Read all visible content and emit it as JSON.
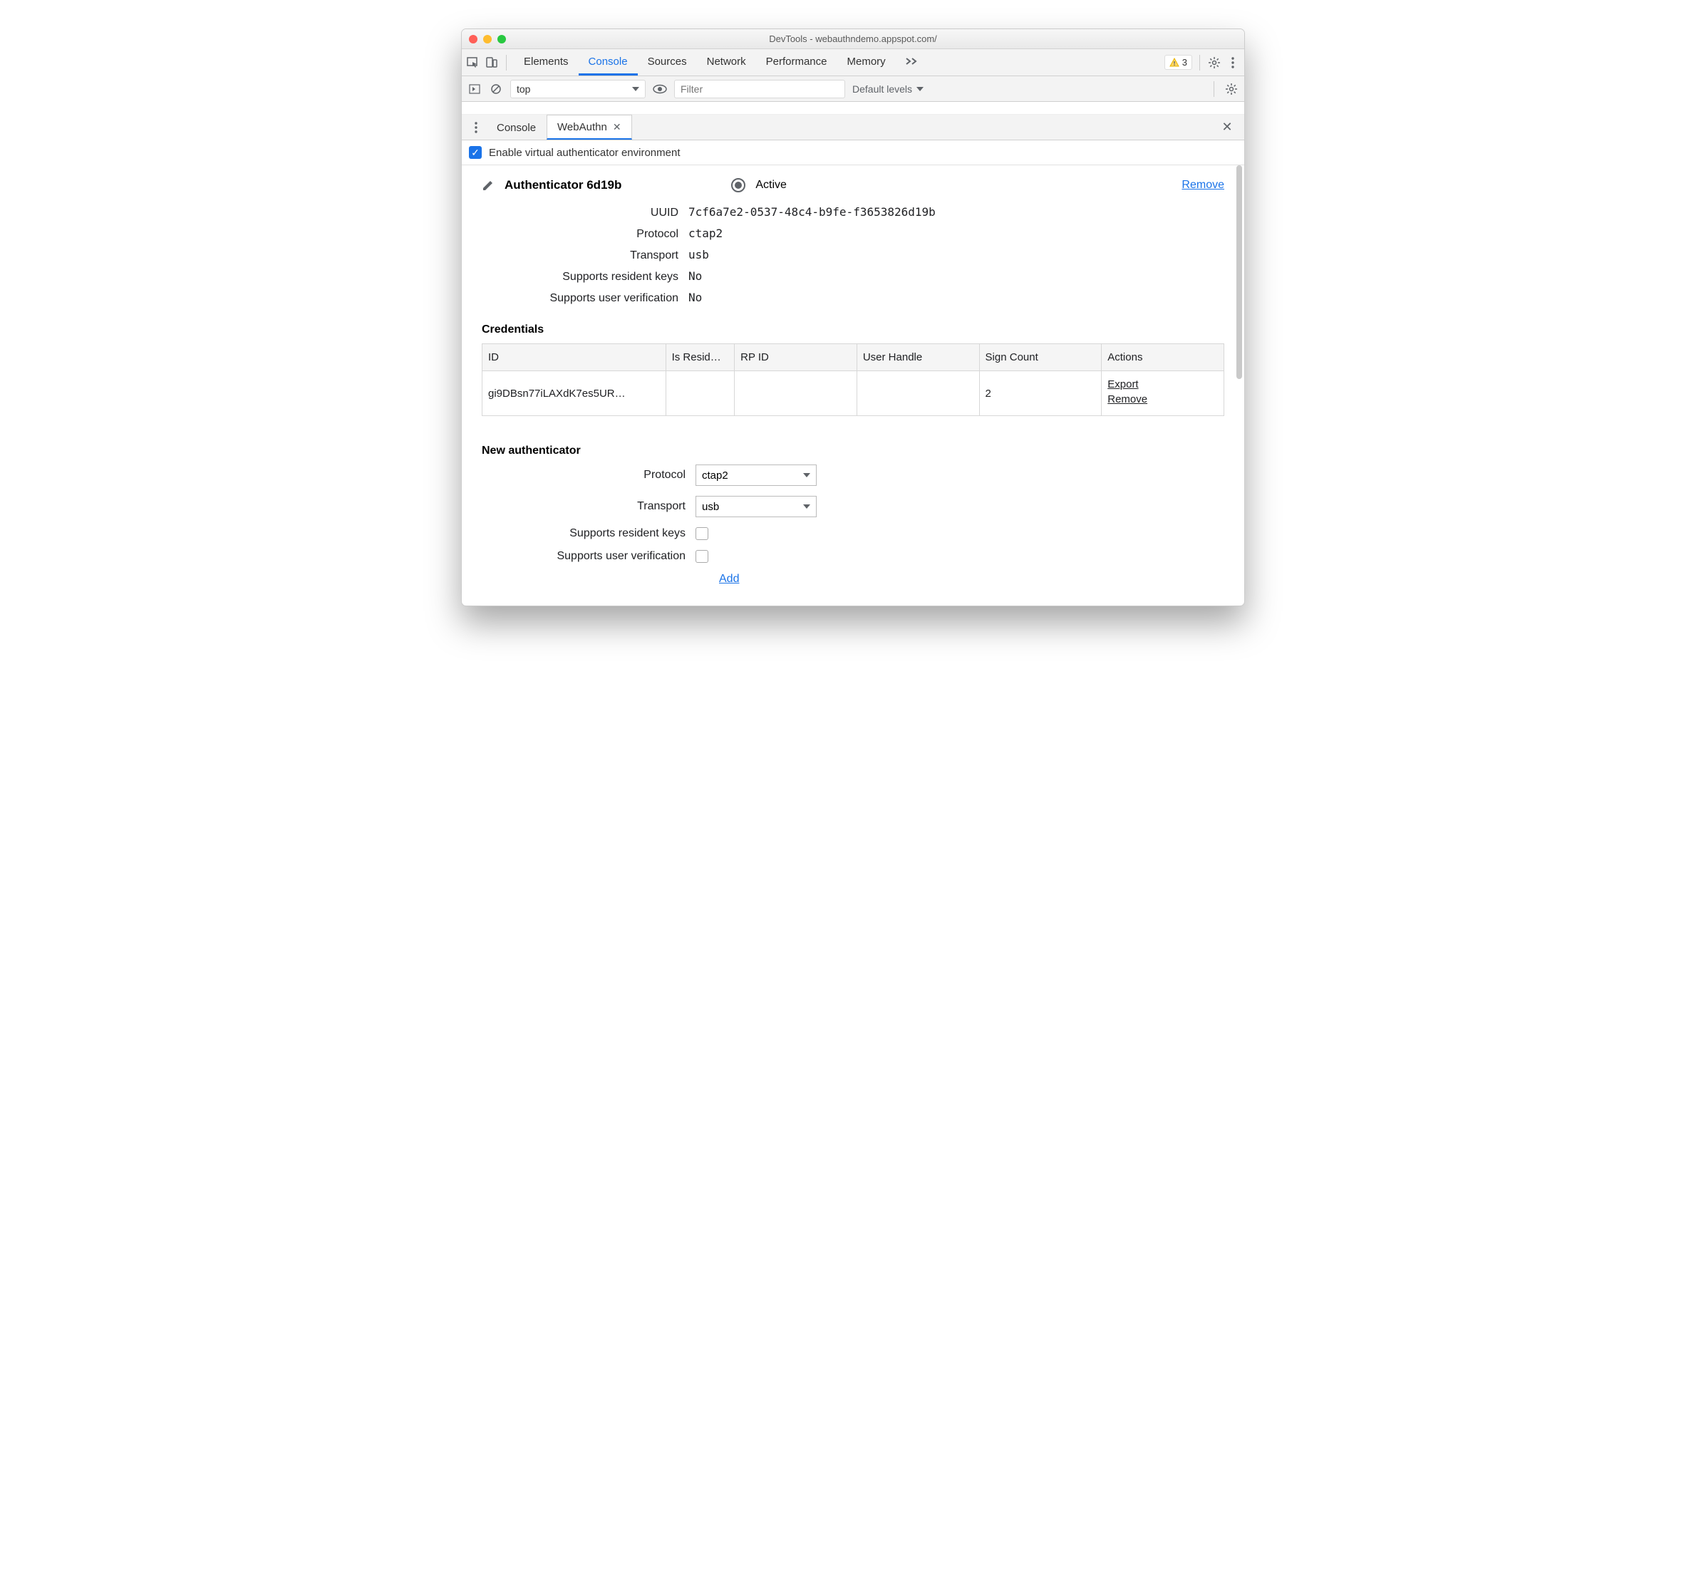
{
  "window": {
    "title": "DevTools - webauthndemo.appspot.com/"
  },
  "tabs": {
    "items": [
      "Elements",
      "Console",
      "Sources",
      "Network",
      "Performance",
      "Memory"
    ],
    "active": "Console"
  },
  "warnings": {
    "count": "3"
  },
  "console_toolbar": {
    "context": "top",
    "filter_placeholder": "Filter",
    "levels": "Default levels"
  },
  "drawer": {
    "tabs": [
      "Console",
      "WebAuthn"
    ],
    "active": "WebAuthn"
  },
  "enable": {
    "checked": true,
    "label": "Enable virtual authenticator environment"
  },
  "authenticator": {
    "title": "Authenticator 6d19b",
    "active_label": "Active",
    "remove_label": "Remove",
    "props": [
      {
        "label": "UUID",
        "value": "7cf6a7e2-0537-48c4-b9fe-f3653826d19b"
      },
      {
        "label": "Protocol",
        "value": "ctap2"
      },
      {
        "label": "Transport",
        "value": "usb"
      },
      {
        "label": "Supports resident keys",
        "value": "No"
      },
      {
        "label": "Supports user verification",
        "value": "No"
      }
    ]
  },
  "credentials": {
    "title": "Credentials",
    "columns": [
      "ID",
      "Is Resid…",
      "RP ID",
      "User Handle",
      "Sign Count",
      "Actions"
    ],
    "rows": [
      {
        "id": "gi9DBsn77iLAXdK7es5UR…",
        "is_resident": "",
        "rp_id": "",
        "user_handle": "",
        "sign_count": "2"
      }
    ],
    "actions": {
      "export": "Export",
      "remove": "Remove"
    }
  },
  "new_auth": {
    "title": "New authenticator",
    "protocol_label": "Protocol",
    "protocol_value": "ctap2",
    "transport_label": "Transport",
    "transport_value": "usb",
    "resident_label": "Supports resident keys",
    "verification_label": "Supports user verification",
    "add_label": "Add"
  }
}
